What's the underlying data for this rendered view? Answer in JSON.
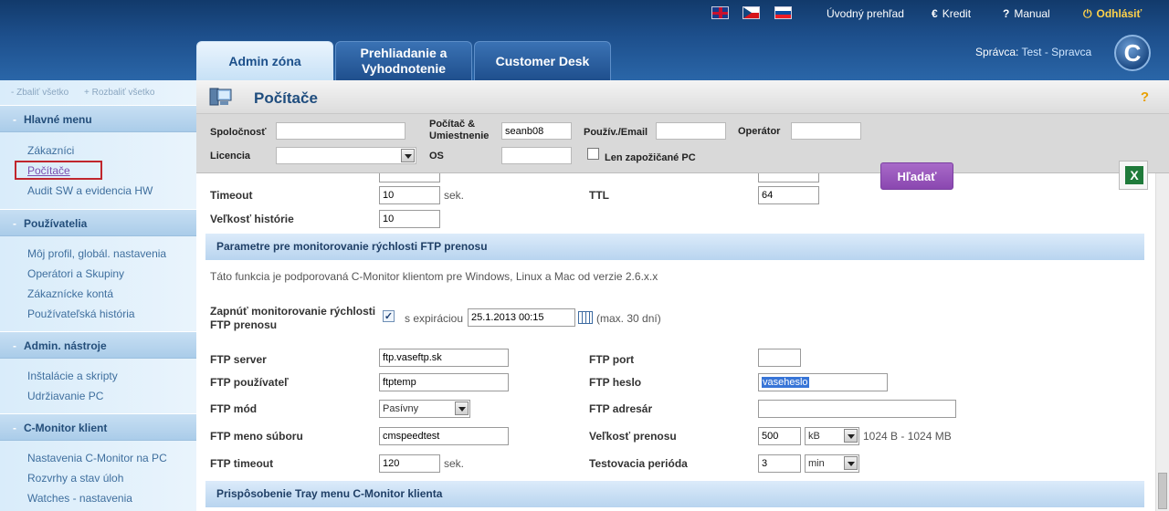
{
  "header": {
    "languages": [
      "English",
      "Čeština",
      "Slovenčina"
    ],
    "links": {
      "home": "Úvodný prehľad",
      "credit": "Kredit",
      "manual": "Manual",
      "logout": "Odhlásiť"
    },
    "tabs": [
      "Admin zóna",
      "Prehliadanie a Vyhodnotenie",
      "Customer Desk"
    ],
    "admin_prefix": "Správca:",
    "admin_name": "Test - Spravca",
    "logo": "C"
  },
  "sidebar": {
    "collapse_all": "- Zbaliť všetko",
    "expand_all": "+ Rozbaliť všetko",
    "sections": [
      {
        "title": "Hlavné menu",
        "items": [
          "Zákazníci",
          "Počítače",
          "Audit SW a evidencia HW"
        ]
      },
      {
        "title": "Používatelia",
        "items": [
          "Môj profil, globál. nastavenia",
          "Operátori a Skupiny",
          "Zákaznícke kontá",
          "Používateľská história"
        ]
      },
      {
        "title": "Admin. nástroje",
        "items": [
          "Inštalácie a skripty",
          "Udržiavanie PC"
        ]
      },
      {
        "title": "C-Monitor klient",
        "items": [
          "Nastavenia C-Monitor na PC",
          "Rozvrhy a stav úloh",
          "Watches - nastavenia"
        ]
      }
    ]
  },
  "page": {
    "title": "Počítače",
    "help": "?"
  },
  "filters": {
    "company_label": "Spoločnosť",
    "company_value": "",
    "pc_label": "Počítač & Umiestnenie",
    "pc_value": "seanb08",
    "user_label": "Použív./Email",
    "user_value": "",
    "operator_label": "Operátor",
    "operator_value": "",
    "license_label": "Licencia",
    "license_value": "",
    "os_label": "OS",
    "os_value": "",
    "loaned_label": "Len zapožičané PC",
    "search_button": "Hľadať",
    "excel": "X"
  },
  "form": {
    "timeout_label": "Timeout",
    "timeout_value": "10",
    "timeout_unit": "sek.",
    "ttl_label": "TTL",
    "ttl_value": "64",
    "history_label": "Veľkosť histórie",
    "history_value": "10",
    "ftp_section_title": "Parametre pre monitorovanie rýchlosti FTP prenosu",
    "ftp_note": "Táto funkcia je podporovaná C-Monitor klientom pre Windows, Linux a Mac od verzie 2.6.x.x",
    "enable_label_1": "Zapnúť monitorovanie rýchlosti",
    "enable_label_2": "FTP prenosu",
    "expiration_label": "s expiráciou",
    "expiration_value": "25.1.2013 00:15",
    "expiration_max": "(max. 30 dní)",
    "ftp_server_label": "FTP server",
    "ftp_server_value": "ftp.vaseftp.sk",
    "ftp_port_label": "FTP port",
    "ftp_port_value": "",
    "ftp_user_label": "FTP používateľ",
    "ftp_user_value": "ftptemp",
    "ftp_password_label": "FTP heslo",
    "ftp_password_value": "vaseheslo",
    "ftp_mode_label": "FTP mód",
    "ftp_mode_value": "Pasívny",
    "ftp_dir_label": "FTP adresár",
    "ftp_dir_value": "",
    "ftp_filename_label": "FTP meno súboru",
    "ftp_filename_value": "cmspeedtest",
    "transfer_size_label": "Veľkosť prenosu",
    "transfer_size_value": "500",
    "transfer_size_unit": "kB",
    "transfer_size_range": "1024 B - 1024 MB",
    "ftp_timeout_label": "FTP timeout",
    "ftp_timeout_value": "120",
    "ftp_timeout_unit": "sek.",
    "test_period_label": "Testovacia perióda",
    "test_period_value": "3",
    "test_period_unit": "min",
    "tray_section_title": "Prispôsobenie Tray menu C-Monitor klienta"
  }
}
